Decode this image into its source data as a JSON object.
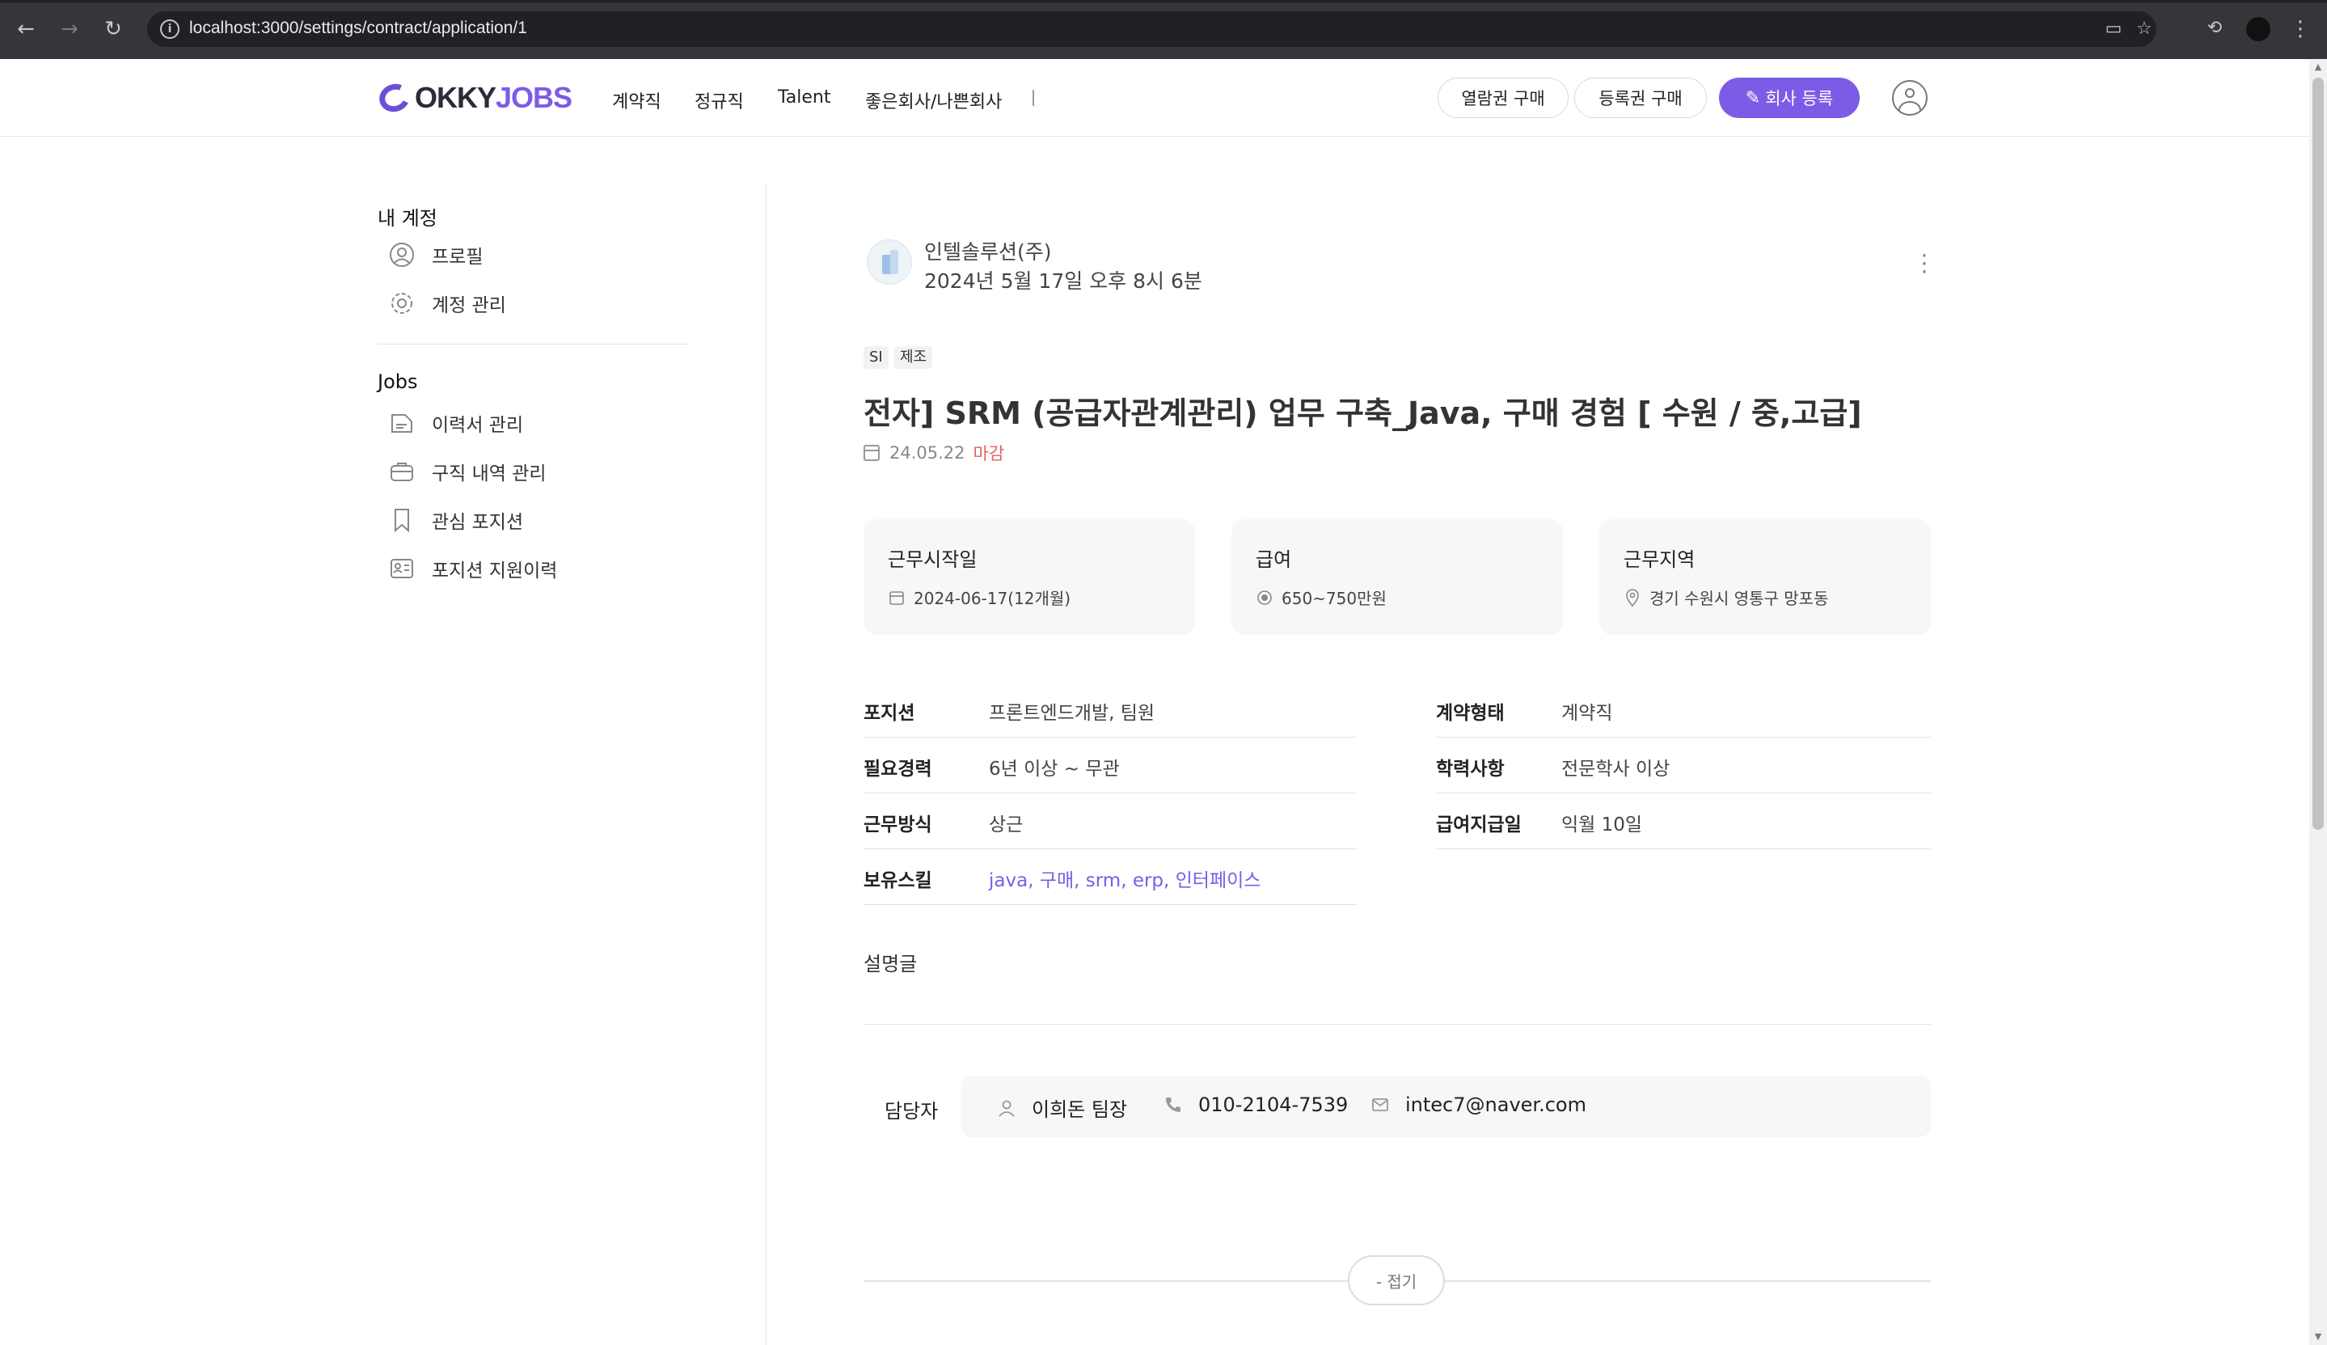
{
  "browser": {
    "url": "localhost:3000/settings/contract/application/1"
  },
  "header": {
    "logo_okky": "OKKY",
    "logo_jobs": "JOBS",
    "nav": [
      "계약직",
      "정규직",
      "Talent",
      "좋은회사/나쁜회사"
    ],
    "buy_view_label": "열람권 구매",
    "buy_register_label": "등록권 구매",
    "register_company_label": "회사 등록"
  },
  "sidebar": {
    "account_title": "내 계정",
    "account_items": [
      {
        "label": "프로필",
        "icon": "profile-icon"
      },
      {
        "label": "계정 관리",
        "icon": "gear-icon"
      }
    ],
    "jobs_title": "Jobs",
    "jobs_items": [
      {
        "label": "이력서 관리",
        "icon": "document-icon"
      },
      {
        "label": "구직 내역 관리",
        "icon": "briefcase-icon"
      },
      {
        "label": "관심 포지션",
        "icon": "bookmark-icon"
      },
      {
        "label": "포지션 지원이력",
        "icon": "id-card-icon"
      }
    ]
  },
  "post": {
    "company_name": "인텔솔루션(주)",
    "posted_at": "2024년 5월 17일 오후 8시 6분",
    "tags": [
      "SI",
      "제조"
    ],
    "title": "전자] SRM (공급자관계관리) 업무 구축_Java, 구매 경험 [ 수원 / 중,고급]",
    "deadline_date": "24.05.22",
    "deadline_status": "마감",
    "cards": [
      {
        "title": "근무시작일",
        "value": "2024-06-17(12개월)",
        "icon": "calendar-icon"
      },
      {
        "title": "급여",
        "value": "650~750만원",
        "icon": "coin-icon"
      },
      {
        "title": "근무지역",
        "value": "경기 수원시 영통구 망포동",
        "icon": "location-icon"
      }
    ],
    "details_left": [
      {
        "key": "포지션",
        "value": "프론트엔드개발, 팀원"
      },
      {
        "key": "필요경력",
        "value": "6년 이상 ~ 무관"
      },
      {
        "key": "근무방식",
        "value": "상근"
      },
      {
        "key": "보유스킬",
        "value": "java, 구매, srm, erp, 인터페이스"
      }
    ],
    "details_right": [
      {
        "key": "계약형태",
        "value": "계약직"
      },
      {
        "key": "학력사항",
        "value": "전문학사 이상"
      },
      {
        "key": "급여지급일",
        "value": "익월 10일"
      }
    ],
    "description_label": "설명글",
    "contact_label": "담당자",
    "contact_name": "이희돈 팀장",
    "contact_phone": "010-2104-7539",
    "contact_email": "intec7@naver.com",
    "fold_label": "- 접기"
  },
  "colors": {
    "brand": "#7c5ce6",
    "closed": "#e85d5d"
  }
}
